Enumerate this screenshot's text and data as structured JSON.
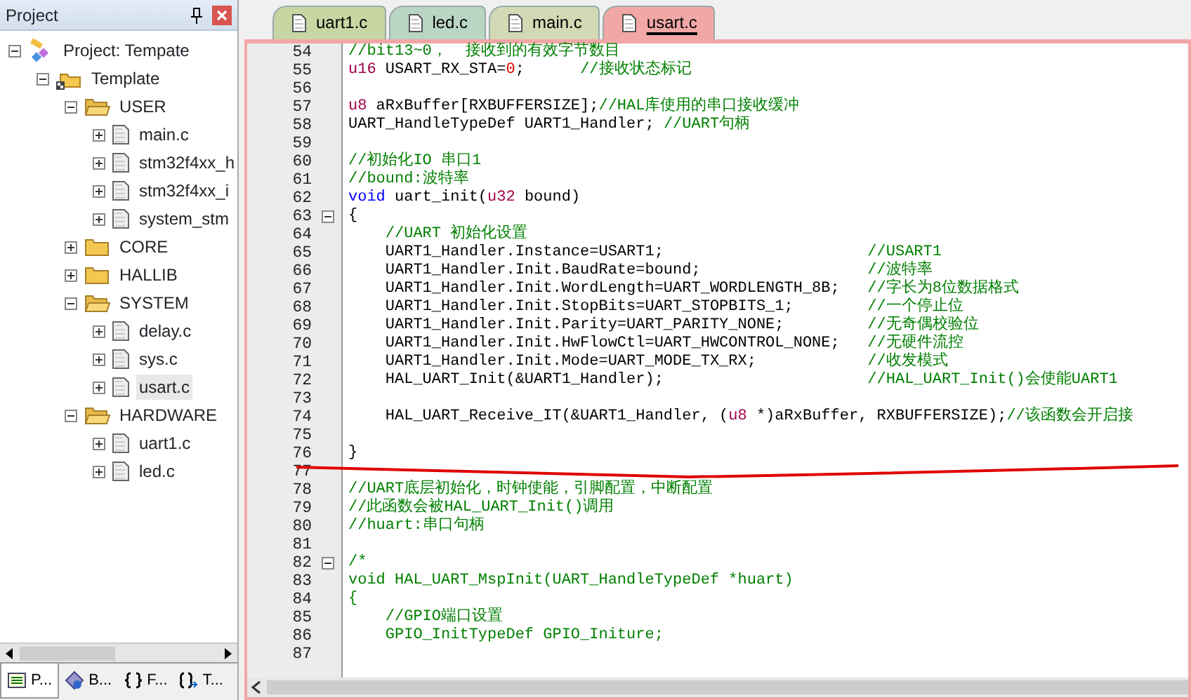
{
  "project_panel": {
    "title": "Project",
    "tree": [
      {
        "kind": "project",
        "label": "Project: Tempate",
        "expanded": true,
        "selected": false,
        "children": [
          {
            "kind": "target",
            "label": "Template",
            "expanded": true,
            "selected": false,
            "children": [
              {
                "kind": "folder",
                "label": "USER",
                "expanded": true,
                "selected": false,
                "children": [
                  {
                    "kind": "file",
                    "label": "main.c",
                    "expanded": false,
                    "selected": false
                  },
                  {
                    "kind": "file",
                    "label": "stm32f4xx_h",
                    "expanded": false,
                    "selected": false
                  },
                  {
                    "kind": "file",
                    "label": "stm32f4xx_i",
                    "expanded": false,
                    "selected": false
                  },
                  {
                    "kind": "file",
                    "label": "system_stm",
                    "expanded": false,
                    "selected": false
                  }
                ]
              },
              {
                "kind": "folder",
                "label": "CORE",
                "expanded": false,
                "selected": false
              },
              {
                "kind": "folder",
                "label": "HALLIB",
                "expanded": false,
                "selected": false
              },
              {
                "kind": "folder",
                "label": "SYSTEM",
                "expanded": true,
                "selected": false,
                "children": [
                  {
                    "kind": "file",
                    "label": "delay.c",
                    "expanded": false,
                    "selected": false
                  },
                  {
                    "kind": "file",
                    "label": "sys.c",
                    "expanded": false,
                    "selected": false
                  },
                  {
                    "kind": "file",
                    "label": "usart.c",
                    "expanded": false,
                    "selected": true
                  }
                ]
              },
              {
                "kind": "folder",
                "label": "HARDWARE",
                "expanded": true,
                "selected": false,
                "children": [
                  {
                    "kind": "file",
                    "label": "uart1.c",
                    "expanded": false,
                    "selected": false
                  },
                  {
                    "kind": "file",
                    "label": "led.c",
                    "expanded": false,
                    "selected": false
                  }
                ]
              }
            ]
          }
        ]
      }
    ],
    "bottom_tabs": [
      {
        "kind": "project",
        "label": "P...",
        "selected": true
      },
      {
        "kind": "books",
        "label": "B...",
        "selected": false
      },
      {
        "kind": "functions",
        "label": "F...",
        "selected": false
      },
      {
        "kind": "templates",
        "label": "T...",
        "selected": false
      }
    ]
  },
  "editor_tabs": [
    {
      "label": "uart1.c",
      "selected": false,
      "color": "#c8d6a4"
    },
    {
      "label": "led.c",
      "selected": false,
      "color": "#b9d5c4"
    },
    {
      "label": "main.c",
      "selected": false,
      "color": "#d3d9b4"
    },
    {
      "label": "usart.c",
      "selected": true,
      "color": "#f2a7a7"
    }
  ],
  "code_lines": [
    {
      "number": "54",
      "spans": [
        {
          "kind": "comment",
          "text": "//bit13~0，  接收到的有效字节数目"
        }
      ]
    },
    {
      "number": "55",
      "spans": [
        {
          "kind": "type",
          "text": "u16"
        },
        {
          "kind": "plain",
          "text": " USART_RX_STA="
        },
        {
          "kind": "number",
          "text": "0"
        },
        {
          "kind": "plain",
          "text": ";      "
        },
        {
          "kind": "comment",
          "text": "//接收状态标记"
        }
      ]
    },
    {
      "number": "56"
    },
    {
      "number": "57",
      "spans": [
        {
          "kind": "type",
          "text": "u8"
        },
        {
          "kind": "plain",
          "text": " aRxBuffer[RXBUFFERSIZE];"
        },
        {
          "kind": "comment",
          "text": "//HAL库使用的串口接收缓冲"
        }
      ]
    },
    {
      "number": "58",
      "spans": [
        {
          "kind": "plain",
          "text": "UART_HandleTypeDef UART1_Handler; "
        },
        {
          "kind": "comment",
          "text": "//UART句柄"
        }
      ]
    },
    {
      "number": "59"
    },
    {
      "number": "60",
      "spans": [
        {
          "kind": "comment",
          "text": "//初始化IO 串口1"
        }
      ]
    },
    {
      "number": "61",
      "spans": [
        {
          "kind": "comment",
          "text": "//bound:波特率"
        }
      ]
    },
    {
      "number": "62",
      "spans": [
        {
          "kind": "keyword",
          "text": "void"
        },
        {
          "kind": "plain",
          "text": " uart_init("
        },
        {
          "kind": "type",
          "text": "u32"
        },
        {
          "kind": "plain",
          "text": " bound)"
        }
      ]
    },
    {
      "number": "63",
      "fold": true,
      "spans": [
        {
          "kind": "plain",
          "text": "{"
        }
      ]
    },
    {
      "number": "64",
      "spans": [
        {
          "kind": "comment",
          "text": "    //UART 初始化设置"
        }
      ]
    },
    {
      "number": "65",
      "spans": [
        {
          "kind": "plain",
          "text": "    UART1_Handler.Instance=USART1;                      "
        },
        {
          "kind": "comment",
          "text": "//USART1"
        }
      ]
    },
    {
      "number": "66",
      "spans": [
        {
          "kind": "plain",
          "text": "    UART1_Handler.Init.BaudRate=bound;                  "
        },
        {
          "kind": "comment",
          "text": "//波特率"
        }
      ]
    },
    {
      "number": "67",
      "spans": [
        {
          "kind": "plain",
          "text": "    UART1_Handler.Init.WordLength=UART_WORDLENGTH_8B;   "
        },
        {
          "kind": "comment",
          "text": "//字长为8位数据格式"
        }
      ]
    },
    {
      "number": "68",
      "spans": [
        {
          "kind": "plain",
          "text": "    UART1_Handler.Init.StopBits=UART_STOPBITS_1;        "
        },
        {
          "kind": "comment",
          "text": "//一个停止位"
        }
      ]
    },
    {
      "number": "69",
      "spans": [
        {
          "kind": "plain",
          "text": "    UART1_Handler.Init.Parity=UART_PARITY_NONE;         "
        },
        {
          "kind": "comment",
          "text": "//无奇偶校验位"
        }
      ]
    },
    {
      "number": "70",
      "spans": [
        {
          "kind": "plain",
          "text": "    UART1_Handler.Init.HwFlowCtl=UART_HWCONTROL_NONE;   "
        },
        {
          "kind": "comment",
          "text": "//无硬件流控"
        }
      ]
    },
    {
      "number": "71",
      "spans": [
        {
          "kind": "plain",
          "text": "    UART1_Handler.Init.Mode=UART_MODE_TX_RX;            "
        },
        {
          "kind": "comment",
          "text": "//收发模式"
        }
      ]
    },
    {
      "number": "72",
      "spans": [
        {
          "kind": "plain",
          "text": "    HAL_UART_Init(&UART1_Handler);                      "
        },
        {
          "kind": "comment",
          "text": "//HAL_UART_Init()会使能UART1"
        }
      ]
    },
    {
      "number": "73"
    },
    {
      "number": "74",
      "spans": [
        {
          "kind": "plain",
          "text": "    HAL_UART_Receive_IT(&UART1_Handler, ("
        },
        {
          "kind": "type",
          "text": "u8"
        },
        {
          "kind": "plain",
          "text": " *)aRxBuffer, RXBUFFERSIZE);"
        },
        {
          "kind": "comment",
          "text": "//该函数会开启接"
        }
      ]
    },
    {
      "number": "75"
    },
    {
      "number": "76",
      "spans": [
        {
          "kind": "plain",
          "text": "}"
        }
      ]
    },
    {
      "number": "77"
    },
    {
      "number": "78",
      "spans": [
        {
          "kind": "comment",
          "text": "//UART底层初始化，时钟使能，引脚配置，中断配置"
        }
      ]
    },
    {
      "number": "79",
      "spans": [
        {
          "kind": "comment",
          "text": "//此函数会被HAL_UART_Init()调用"
        }
      ]
    },
    {
      "number": "80",
      "spans": [
        {
          "kind": "comment",
          "text": "//huart:串口句柄"
        }
      ]
    },
    {
      "number": "81"
    },
    {
      "number": "82",
      "fold": true,
      "spans": [
        {
          "kind": "comment",
          "text": "/*"
        }
      ]
    },
    {
      "number": "83",
      "spans": [
        {
          "kind": "comment",
          "text": "void HAL_UART_MspInit(UART_HandleTypeDef *huart)"
        }
      ]
    },
    {
      "number": "84",
      "spans": [
        {
          "kind": "comment",
          "text": "{"
        }
      ]
    },
    {
      "number": "85",
      "spans": [
        {
          "kind": "comment",
          "text": "    //GPIO端口设置"
        }
      ]
    },
    {
      "number": "86",
      "spans": [
        {
          "kind": "comment",
          "text": "    GPIO_InitTypeDef GPIO_Initure;"
        }
      ]
    },
    {
      "number": "87"
    }
  ]
}
